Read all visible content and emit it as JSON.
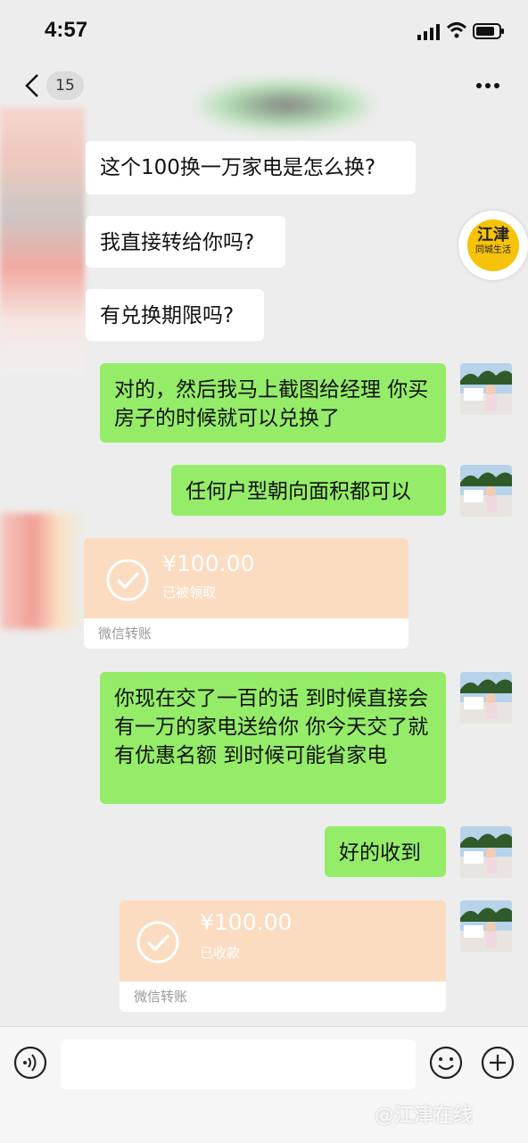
{
  "status": {
    "time": "4:57"
  },
  "nav": {
    "unread_count": "15"
  },
  "badge": {
    "line1": "江津",
    "line2": "同城生活"
  },
  "messages": {
    "m1": "这个100换一万家电是怎么换?",
    "m2": "我直接转给你吗?",
    "m3": "有兑换期限吗?",
    "m4": "对的，然后我马上截图给经理 你买房子的时候就可以兑换了",
    "m5": "任何户型朝向面积都可以",
    "m6": "你现在交了一百的话 到时候直接会有一万的家电送给你 你今天交了就有优惠名额 到时候可能省家电",
    "m7": "好的收到"
  },
  "transfer1": {
    "amount": "¥100.00",
    "status": "已被领取",
    "label": "微信转账"
  },
  "transfer2": {
    "amount": "¥100.00",
    "status": "已收款",
    "label": "微信转账"
  },
  "watermark": "@江津在线",
  "colors": {
    "sent_bubble": "#95ec69",
    "received_bubble": "#ffffff",
    "transfer": "#fcdcc1",
    "background": "#ededed"
  }
}
